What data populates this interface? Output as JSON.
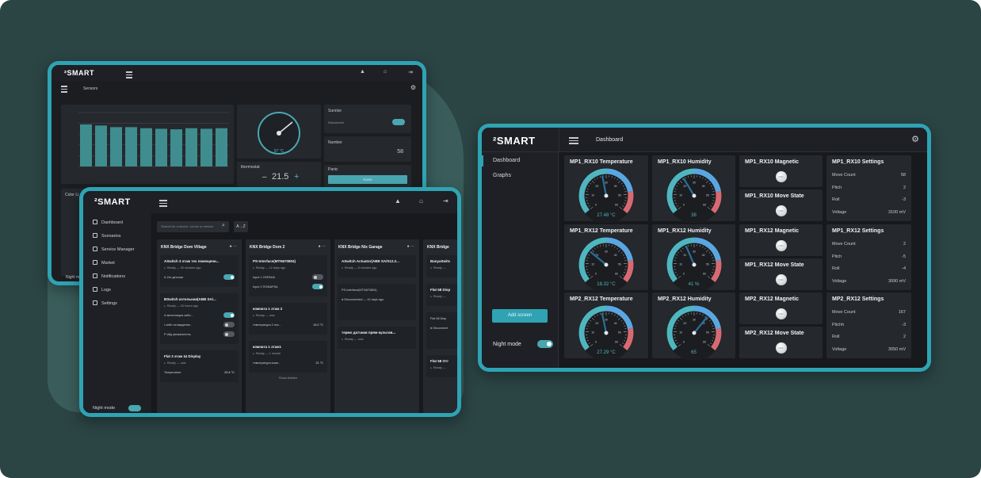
{
  "brand": "²SMART",
  "right_panel": {
    "title": "Dashboard",
    "nav": [
      "Dashboard",
      "Graphs"
    ],
    "add_screen": "Add screen",
    "night_mode": "Night mode",
    "cards": [
      {
        "title": "MP1_RX10 Temperature",
        "value": "27.48 °C"
      },
      {
        "title": "MP1_RX10 Humidity",
        "value": "38"
      },
      {
        "title": "MP1_RX12 Temperature",
        "value": "18.32 °C"
      },
      {
        "title": "MP1_RX12 Humidity",
        "value": "41 %"
      },
      {
        "title": "MP2_RX12 Temperature",
        "value": "27.29 °C"
      },
      {
        "title": "MP2_RX12 Humidity",
        "value": "65"
      }
    ],
    "gauge_ticks": [
      "0",
      "10",
      "20",
      "30",
      "40",
      "50",
      "60"
    ],
    "switches": [
      {
        "title": "MP1_RX10 Magnetic",
        "btn": "OFF"
      },
      {
        "title": "MP1_RX10 Move State",
        "btn": "OFF"
      },
      {
        "title": "MP1_RX12 Magnetic",
        "btn": "OFF"
      },
      {
        "title": "MP1_RX12 Move State",
        "btn": "OFF"
      },
      {
        "title": "MP2_RX12 Magnetic",
        "btn": "OFF"
      },
      {
        "title": "MP2_RX12 Move State",
        "btn": "OFF"
      }
    ],
    "settings": [
      {
        "title": "MP1_RX10 Settings",
        "rows": [
          [
            "Move Count",
            "58"
          ],
          [
            "Pitch",
            "2"
          ],
          [
            "Roll",
            "-3"
          ],
          [
            "Voltage",
            "3100 mV"
          ]
        ]
      },
      {
        "title": "MP1_RX12 Settings",
        "rows": [
          [
            "Move Count",
            "2"
          ],
          [
            "Pitch",
            "-5"
          ],
          [
            "Roll",
            "-4"
          ],
          [
            "Voltage",
            "3090 mV"
          ]
        ]
      },
      {
        "title": "MP2_RX12 Settings",
        "rows": [
          [
            "Move Count",
            "167"
          ],
          [
            "Pitchh",
            "-3"
          ],
          [
            "Roll",
            "2"
          ],
          [
            "Voltage",
            "3050 mV"
          ]
        ]
      }
    ]
  },
  "back_panel": {
    "title": "Sensors",
    "sunrise": "Sunrise",
    "disconnect": "Disconnect",
    "number": "Number",
    "number_value": "58",
    "thermostat": "thermostat",
    "thermo_value": "21.5",
    "panic": "Panic",
    "push": "PUSH",
    "color_label": "Color Li",
    "gauge_value": "97 °C",
    "night": "Night m",
    "bars": [
      0.78,
      0.76,
      0.73,
      0.73,
      0.71,
      0.7,
      0.69,
      0.71,
      0.7,
      0.71
    ]
  },
  "front_panel": {
    "nav": [
      "Dashboard",
      "Scenarios",
      "Service Manager",
      "Market",
      "Notifications",
      "Logs",
      "Settings"
    ],
    "night_mode": "Night mode",
    "search_placeholder": "Search for a device, rooms or service",
    "sort": "A→Z",
    "columns": [
      {
        "title": "KNX Bridge Dom Village",
        "cards": [
          {
            "title": "ASwitch 3 этаж тех помещени...",
            "status": "Ready — 30 minutes ago",
            "rows": [
              [
                "А 2эт детская",
                "on"
              ]
            ]
          },
          {
            "title": "BSwitch котельная(ABB SA/...",
            "status": "Ready — 16 hours ago",
            "rows": [
              [
                "А вентиляция каби...",
                "on"
              ],
              [
                "I сейн охлаждение...",
                "off"
              ],
              [
                "P ябд увлажнитель",
                "off"
              ]
            ]
          },
          {
            "title": "Flat 3 этаж Ш Display",
            "status": "Ready — now",
            "rows": [
              [
                "Temperature",
                "29.4 °C"
              ]
            ]
          }
        ]
      },
      {
        "title": "KNX Bridge Dom 2",
        "cards": [
          {
            "title": "PS-Interface(MTN670804)",
            "status": "Ready — 12 days ago",
            "rows": [
              [
                "Input 1 ОХРАНА",
                "off"
              ],
              [
                "Input 2 ПОЖАРКА",
                "on"
              ]
            ]
          },
          {
            "title": "комната 1 этаж 2",
            "status": "Ready — now",
            "rows": [
              [
                "температура 2 эта...",
                "19.2 °C"
              ]
            ]
          },
          {
            "title": "комната 1 этаж1",
            "status": "Ready — 1 minute",
            "rows": [
              [
                "температура комн...",
                "21 °C"
              ]
            ]
          }
        ],
        "show_hidden": "Show hidden"
      },
      {
        "title": "KNX Bridge Nix Garage",
        "cards": [
          {
            "title": "ASwitch Actuator(ABB SA/S12.2...",
            "status": "Ready — 8 minutes ago",
            "rows": []
          },
          {
            "title": "",
            "status": "",
            "rows": [
              [
                "PS-Interface(MTN670804)",
                ""
              ],
              [
                "● Disconnected — 12 days ago",
                ""
              ]
            ]
          },
          {
            "title": "термо датчики прям-культив...",
            "status": "Ready — now",
            "rows": []
          }
        ]
      },
      {
        "title": "KNX Bridge",
        "cards": [
          {
            "title": "BanyaSwitc",
            "status": "Ready —",
            "rows": []
          },
          {
            "title": "Flat 58 Disp",
            "status": "Ready —",
            "rows": []
          },
          {
            "title": "",
            "status": "",
            "rows": [
              [
                "Flat 58 Disp",
                ""
              ],
              [
                "● Disconnect",
                ""
              ]
            ]
          },
          {
            "title": "Flat 58 Отг",
            "status": "Ready —",
            "rows": []
          }
        ]
      }
    ]
  }
}
